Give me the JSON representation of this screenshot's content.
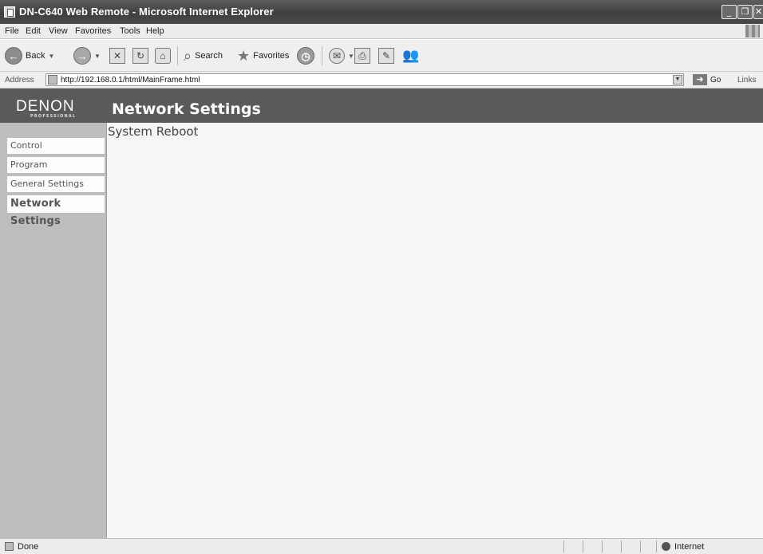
{
  "window": {
    "title": "DN-C640 Web Remote - Microsoft Internet Explorer",
    "minimize_glyph": "_",
    "restore_glyph": "❐",
    "close_glyph": "✕"
  },
  "menu": {
    "items": [
      "File",
      "Edit",
      "View",
      "Favorites",
      "Tools",
      "Help"
    ]
  },
  "toolbar": {
    "back_label": "Back",
    "search_label": "Search",
    "favorites_label": "Favorites"
  },
  "address": {
    "label": "Address",
    "url": "http://192.168.0.1/html/MainFrame.html",
    "go_label": "Go",
    "links_label": "Links"
  },
  "page": {
    "logo_text": "DENON",
    "logo_subtext": "PROFESSIONAL",
    "title": "Network Settings",
    "section_heading": "System Reboot",
    "nav": [
      "Control",
      "Program",
      "General Settings",
      "Network Settings"
    ],
    "active_nav": "Network Settings"
  },
  "status": {
    "text": "Done",
    "zone": "Internet"
  },
  "icons": {
    "back": "back-arrow-icon",
    "forward": "forward-arrow-icon",
    "stop": "stop-icon",
    "refresh": "refresh-icon",
    "home": "home-icon",
    "search": "search-icon",
    "favorites": "favorites-star-icon",
    "history": "history-icon",
    "mail": "mail-icon",
    "print": "print-icon",
    "edit": "edit-icon",
    "messenger": "messenger-icon"
  }
}
